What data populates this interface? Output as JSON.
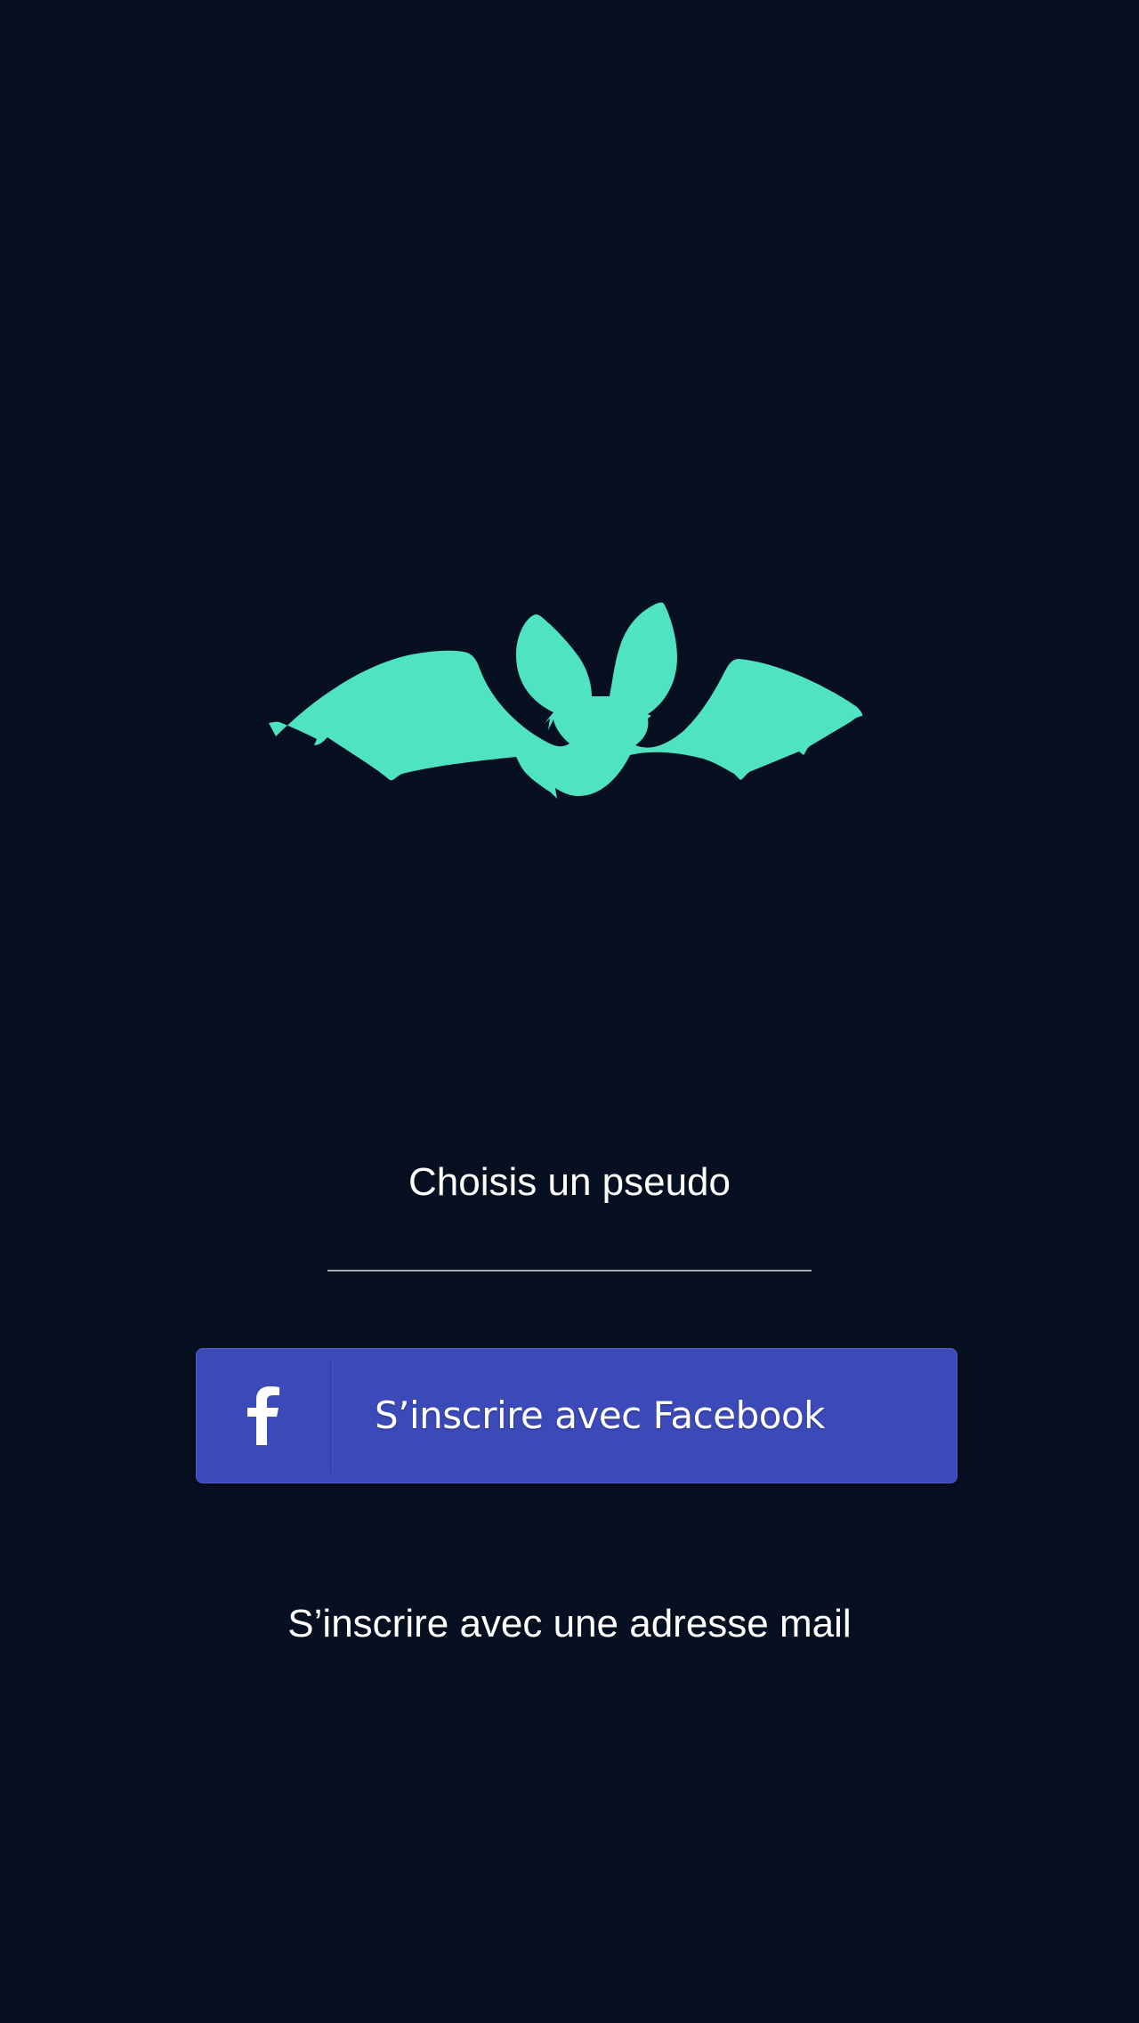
{
  "logo": {
    "icon": "bat-icon",
    "color": "#50e3c2"
  },
  "pseudo": {
    "label": "Choisis un pseudo",
    "value": "",
    "placeholder": ""
  },
  "facebook_button": {
    "label": "S’inscrire avec Facebook",
    "icon": "facebook-icon",
    "color": "#3c4ab9"
  },
  "email_signup": {
    "label": "S’inscrire avec une adresse mail"
  },
  "colors": {
    "background": "#061020",
    "text": "#ffffff",
    "accent": "#50e3c2"
  }
}
